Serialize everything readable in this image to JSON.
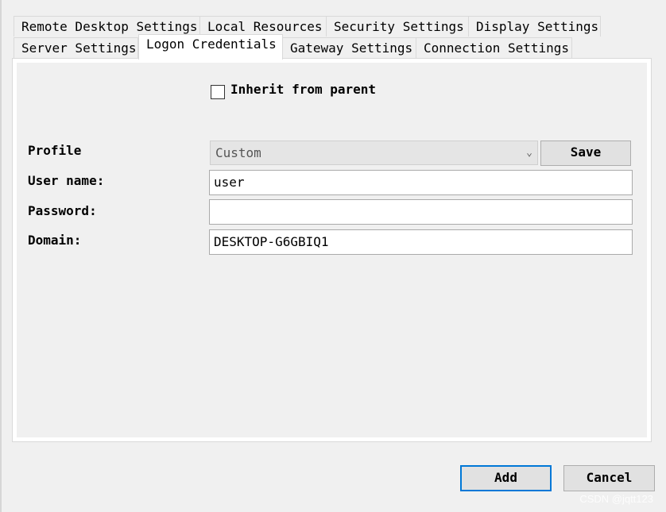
{
  "tabs": {
    "row1": [
      {
        "label": "Remote Desktop Settings"
      },
      {
        "label": "Local Resources"
      },
      {
        "label": "Security Settings"
      },
      {
        "label": "Display Settings"
      }
    ],
    "row2": [
      {
        "label": "Server Settings"
      },
      {
        "label": "Logon Credentials",
        "active": true
      },
      {
        "label": "Gateway Settings"
      },
      {
        "label": "Connection Settings"
      }
    ]
  },
  "inherit": {
    "label": "Inherit from parent",
    "checked": false
  },
  "profile": {
    "label": "Profile",
    "value": "Custom",
    "save_label": "Save"
  },
  "username": {
    "label": "User name:",
    "value": "user"
  },
  "password": {
    "label": "Password:",
    "value": ""
  },
  "domain": {
    "label": "Domain:",
    "value": "DESKTOP-G6GBIQ1"
  },
  "footer": {
    "add_label": "Add",
    "cancel_label": "Cancel"
  },
  "watermark": "CSDN @jqtt123"
}
